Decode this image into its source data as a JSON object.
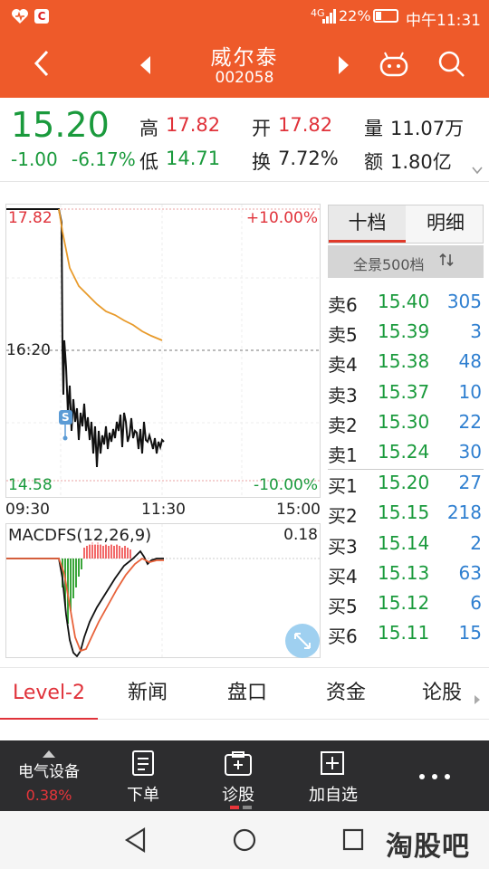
{
  "status": {
    "network": "4G",
    "battery": "22%",
    "time": "中午11:31"
  },
  "header": {
    "name": "威尔泰",
    "code": "002058"
  },
  "quote": {
    "price": "15.20",
    "change": "-1.00",
    "change_pct": "-6.17%",
    "high_label": "高",
    "high": "17.82",
    "open_label": "开",
    "open": "17.82",
    "vol_label": "量",
    "vol": "11.07万",
    "low_label": "低",
    "low": "14.71",
    "turn_label": "换",
    "turn": "7.72%",
    "amt_label": "额",
    "amt": "1.80亿"
  },
  "chart": {
    "y_top": "17.82",
    "y_mid": "16:20",
    "y_bottom": "14.58",
    "pct_top": "+10.00%",
    "pct_bottom": "-10.00%",
    "x_start": "09:30",
    "x_mid": "11:30",
    "x_end": "15:00",
    "signal": "S",
    "macd_label": "MACDFS(12,26,9)",
    "macd_max": "0.18"
  },
  "orderbook": {
    "tab1": "十档",
    "tab2": "明细",
    "full_label": "全景500档",
    "asks": [
      {
        "label": "卖6",
        "price": "15.40",
        "vol": "305"
      },
      {
        "label": "卖5",
        "price": "15.39",
        "vol": "3"
      },
      {
        "label": "卖4",
        "price": "15.38",
        "vol": "48"
      },
      {
        "label": "卖3",
        "price": "15.37",
        "vol": "10"
      },
      {
        "label": "卖2",
        "price": "15.30",
        "vol": "22"
      },
      {
        "label": "卖1",
        "price": "15.24",
        "vol": "30"
      }
    ],
    "bids": [
      {
        "label": "买1",
        "price": "15.20",
        "vol": "27"
      },
      {
        "label": "买2",
        "price": "15.15",
        "vol": "218"
      },
      {
        "label": "买3",
        "price": "15.14",
        "vol": "2"
      },
      {
        "label": "买4",
        "price": "15.13",
        "vol": "63"
      },
      {
        "label": "买5",
        "price": "15.12",
        "vol": "6"
      },
      {
        "label": "买6",
        "price": "15.11",
        "vol": "15"
      }
    ]
  },
  "tabs": [
    "Level-2",
    "新闻",
    "盘口",
    "资金",
    "论股"
  ],
  "toolbar": {
    "sector": "电气设备",
    "sector_pct": "0.38%",
    "order": "下单",
    "diagnose": "诊股",
    "add_watch": "加自选"
  },
  "watermark": "淘股吧"
}
